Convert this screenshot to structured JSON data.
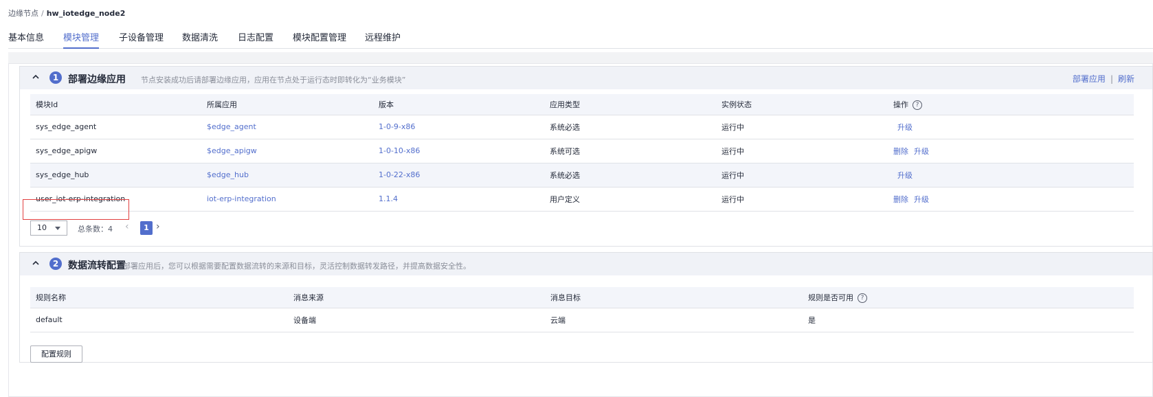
{
  "breadcrumb": {
    "parent": "边缘节点",
    "separator": "/",
    "current": "hw_iotedge_node2"
  },
  "tabs": [
    {
      "label": "基本信息"
    },
    {
      "label": "模块管理",
      "active": true
    },
    {
      "label": "子设备管理"
    },
    {
      "label": "数据清洗"
    },
    {
      "label": "日志配置"
    },
    {
      "label": "模块配置管理"
    },
    {
      "label": "远程维护"
    }
  ],
  "section1": {
    "number": "1",
    "title": "部署边缘应用",
    "description": "节点安装成功后请部署边缘应用，应用在节点处于运行态时即转化为“业务模块”",
    "actions": {
      "deploy": "部署应用",
      "divider": "|",
      "refresh": "刷新"
    },
    "columns": [
      "模块Id",
      "所属应用",
      "版本",
      "应用类型",
      "实例状态",
      "操作"
    ],
    "rows": [
      {
        "module_id": "sys_edge_agent",
        "app": "$edge_agent",
        "version": "1-0-9-x86",
        "type": "系统必选",
        "status": "运行中",
        "ops": [
          "升级"
        ]
      },
      {
        "module_id": "sys_edge_apigw",
        "app": "$edge_apigw",
        "version": "1-0-10-x86",
        "type": "系统可选",
        "status": "运行中",
        "ops": [
          "删除",
          "升级"
        ]
      },
      {
        "module_id": "sys_edge_hub",
        "app": "$edge_hub",
        "version": "1-0-22-x86",
        "type": "系统必选",
        "status": "运行中",
        "ops": [
          "升级"
        ]
      },
      {
        "module_id": "user_iot-erp-integration",
        "app": "iot-erp-integration",
        "version": "1.1.4",
        "type": "用户定义",
        "status": "运行中",
        "ops": [
          "删除",
          "升级"
        ]
      }
    ],
    "pager": {
      "page_size": "10",
      "total_label": "总条数：",
      "total": "4",
      "current_page": "1",
      "prev": "‹",
      "next": "›"
    }
  },
  "section2": {
    "number": "2",
    "title": "数据流转配置",
    "description": "部署应用后，您可以根据需要配置数据流转的来源和目标，灵活控制数据转发路径，并提高数据安全性。",
    "columns": [
      "规则名称",
      "消息来源",
      "消息目标",
      "规则是否可用"
    ],
    "rows": [
      {
        "name": "default",
        "source": "设备端",
        "target": "云端",
        "enabled": "是"
      }
    ],
    "button": "配置规则"
  },
  "icons": {
    "help": "?"
  },
  "colors": {
    "accent": "#526ecc",
    "highlight": "#e13e3e",
    "header_bg": "#f0f2f7"
  }
}
